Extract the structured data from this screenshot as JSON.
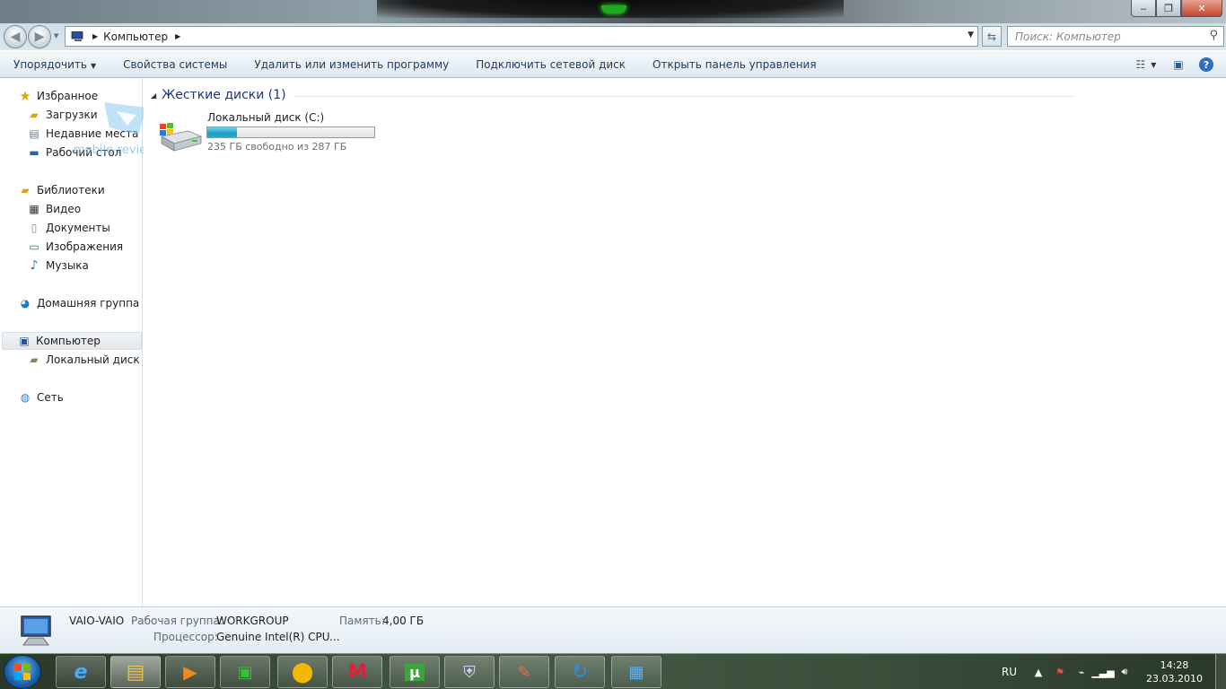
{
  "window": {
    "caption_buttons": {
      "minimize": "‒",
      "maximize": "❐",
      "close": "✕"
    }
  },
  "address": {
    "segments": [
      "Компьютер"
    ],
    "search_placeholder": "Поиск: Компьютер"
  },
  "toolbar": {
    "organize": "Упорядочить",
    "system_properties": "Свойства системы",
    "uninstall": "Удалить или изменить программу",
    "map_drive": "Подключить сетевой диск",
    "control_panel": "Открыть панель управления"
  },
  "nav": {
    "favorites": "Избранное",
    "downloads": "Загрузки",
    "recent": "Недавние места",
    "desktop": "Рабочий стол",
    "libraries": "Библиотеки",
    "video": "Видео",
    "documents": "Документы",
    "images": "Изображения",
    "music": "Музыка",
    "homegroup": "Домашняя группа",
    "computer": "Компьютер",
    "local_disk": "Локальный диск (C",
    "network": "Сеть"
  },
  "watermark": "mobile-review.com",
  "content": {
    "group_title": "Жесткие диски (1)",
    "drive": {
      "name": "Локальный диск (C:)",
      "free_text": "235 ГБ свободно из 287 ГБ",
      "used_fraction": 0.18
    }
  },
  "details": {
    "computer_name": "VAIO-VAIO",
    "workgroup_label": "Рабочая группа:",
    "workgroup_value": "WORKGROUP",
    "memory_label": "Память:",
    "memory_value": "4,00 ГБ",
    "cpu_label": "Процессор:",
    "cpu_value": "Genuine Intel(R) CPU",
    "ellipsis": "..."
  },
  "taskbar": {
    "language": "RU",
    "time": "14:28",
    "date": "23.03.2010",
    "apps": [
      "internet-explorer",
      "windows-explorer",
      "media-player",
      "media-center",
      "app-yellow",
      "app-m",
      "utorrent",
      "security",
      "paint",
      "sync",
      "control-panel"
    ]
  }
}
